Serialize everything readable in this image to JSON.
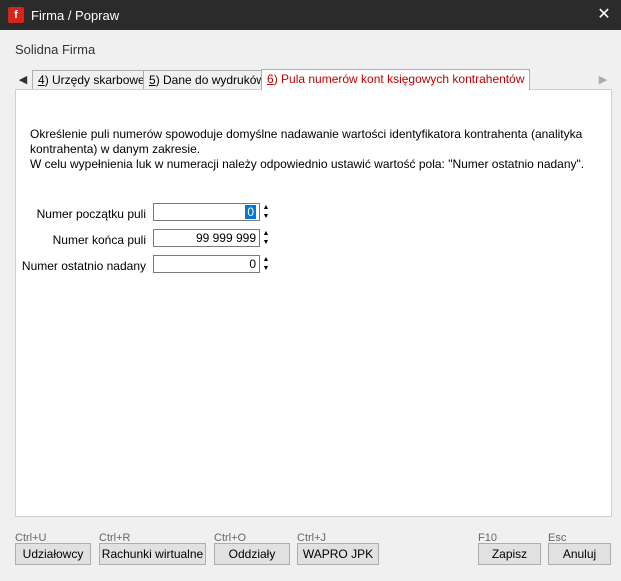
{
  "window": {
    "title": "Firma / Popraw",
    "app_icon_letter": "f"
  },
  "firm_name": "Solidna Firma",
  "tabs": [
    {
      "num": "4",
      "label": ") Urzędy skarbowe",
      "active": false
    },
    {
      "num": "5",
      "label": ") Dane do wydruków",
      "active": false
    },
    {
      "num": "6",
      "label": ") Pula numerów kont księgowych kontrahentów",
      "active": true
    }
  ],
  "description": {
    "line1": "Określenie puli numerów spowoduje domyślne nadawanie wartości identyfikatora kontrahenta (analityka kontrahenta) w danym zakresie.",
    "line2": "W celu wypełnienia luk w numeracji należy odpowiednio ustawić wartość pola: \"Numer ostatnio nadany\"."
  },
  "fields": [
    {
      "label": "Numer początku puli",
      "value": "0"
    },
    {
      "label": "Numer końca puli",
      "value": "99 999 999"
    },
    {
      "label": "Numer ostatnio nadany",
      "value": "0"
    }
  ],
  "footer": {
    "udzialowcy": {
      "shortcut": "Ctrl+U",
      "label": "Udziałowcy"
    },
    "rachunki": {
      "shortcut": "Ctrl+R",
      "label": "Rachunki wirtualne"
    },
    "oddzialy": {
      "shortcut": "Ctrl+O",
      "label": "Oddziały"
    },
    "jpk": {
      "shortcut": "Ctrl+J",
      "label": "WAPRO JPK"
    },
    "zapisz": {
      "shortcut": "F10",
      "label": "Zapisz"
    },
    "anuluj": {
      "shortcut": "Esc",
      "label": "Anuluj"
    }
  }
}
